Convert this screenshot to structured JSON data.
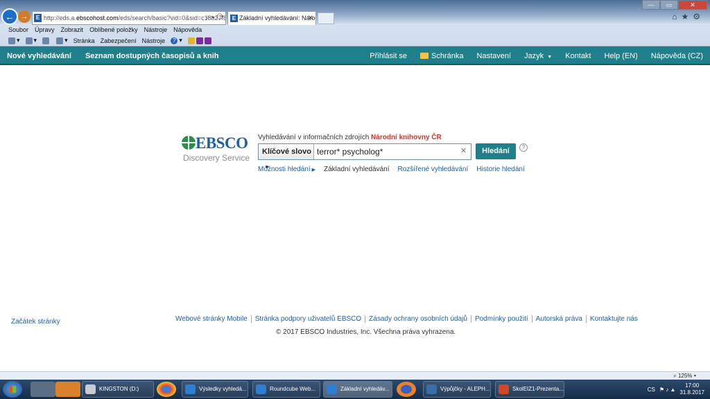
{
  "browser": {
    "address": {
      "prefix": "http://eds.a.",
      "host": "ebscohost.com",
      "path": "/eds/search/basic?vid=0&sid=c18b27f8-"
    },
    "tab_title": "Základní vyhledávání: Náro",
    "menu": [
      "Soubor",
      "Úpravy",
      "Zobrazit",
      "Oblíbené položky",
      "Nástroje",
      "Nápověda"
    ],
    "commands": [
      "Stránka",
      "Zabezpečení",
      "Nástroje"
    ],
    "zoom": "125%"
  },
  "topnav": {
    "left": [
      "Nové vyhledávání",
      "Seznam dostupných časopisů a knih"
    ],
    "right": [
      "Přihlásit se",
      "Schránka",
      "Nastavení",
      "Jazyk",
      "Kontakt",
      "Help (EN)",
      "Nápověda (CZ)"
    ]
  },
  "logo": {
    "brand": "EBSCO",
    "sub": "Discovery Service"
  },
  "search": {
    "intro": "Vyhledávání v informačních zdrojích",
    "library": "Národní knihovny ČR",
    "field": "Klíčové slovo",
    "query": "terror* psycholog*",
    "button": "Hledání",
    "help": "?",
    "links": {
      "options": "Možnosti hledání",
      "basic": "Základní vyhledávání",
      "advanced": "Rozšířené vyhledávání",
      "history": "Historie hledání"
    }
  },
  "footer": {
    "top": "Začátek stránky",
    "links": [
      "Webové stránky Mobile",
      "Stránka podpory uživatelů EBSCO",
      "Zásady ochrany osobních údajů",
      "Podmínky použití",
      "Autorská práva",
      "Kontaktujte nás"
    ],
    "copyright": "© 2017 EBSCO Industries, Inc. Všechna práva vyhrazena."
  },
  "taskbar": {
    "items": [
      "KINGSTON (D:)",
      "Výsledky vyhledá...",
      "Roundcube Web...",
      "Základní vyhledáv...",
      "Výpůjčky - ALEPH...",
      "SkolEIZ1-Prezenta..."
    ],
    "lang": "CS",
    "time": "17:00",
    "date": "31.8.2017"
  },
  "colors": {
    "accent": "#1f7f8a",
    "link": "#1e5fa8",
    "library": "#c0392b"
  }
}
